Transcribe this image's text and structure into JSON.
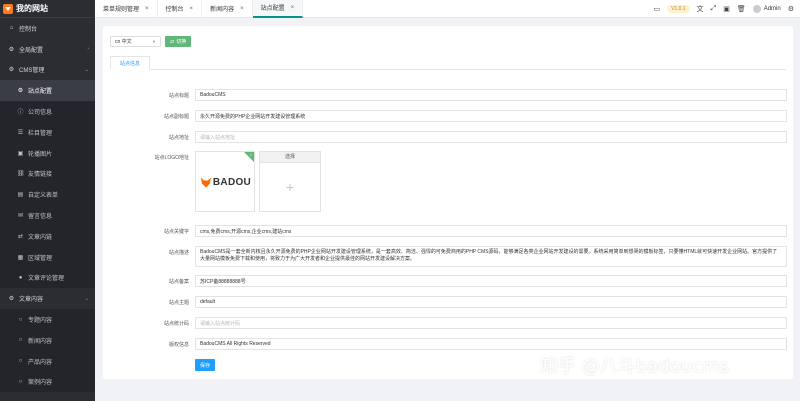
{
  "app": {
    "title": "我的网站"
  },
  "sidebar": {
    "items": [
      {
        "label": "控制台",
        "icon": "dashboard-icon",
        "kind": "top"
      },
      {
        "label": "全局配置",
        "icon": "gear-icon",
        "kind": "top",
        "arrow": "›"
      },
      {
        "label": "CMS管理",
        "icon": "gear-icon",
        "kind": "top",
        "arrow": "⌄"
      },
      {
        "label": "站点配置",
        "icon": "gear-icon",
        "kind": "sub",
        "active": true
      },
      {
        "label": "公司信息",
        "icon": "info-icon",
        "kind": "sub"
      },
      {
        "label": "栏目管理",
        "icon": "list-icon",
        "kind": "sub"
      },
      {
        "label": "轮播图片",
        "icon": "image-icon",
        "kind": "sub"
      },
      {
        "label": "友情链接",
        "icon": "link-icon",
        "kind": "sub"
      },
      {
        "label": "自定义表单",
        "icon": "form-icon",
        "kind": "sub"
      },
      {
        "label": "留言信息",
        "icon": "message-icon",
        "kind": "sub"
      },
      {
        "label": "文章内链",
        "icon": "shuffle-icon",
        "kind": "sub"
      },
      {
        "label": "区域管理",
        "icon": "region-icon",
        "kind": "sub"
      },
      {
        "label": "文章评论管理",
        "icon": "comment-icon",
        "kind": "sub"
      },
      {
        "label": "文章内容",
        "icon": "gear-icon",
        "kind": "top",
        "arrow": "⌄"
      },
      {
        "label": "专题内容",
        "icon": "circle-icon",
        "kind": "sub"
      },
      {
        "label": "新闻内容",
        "icon": "circle-icon",
        "kind": "sub"
      },
      {
        "label": "产品内容",
        "icon": "circle-icon",
        "kind": "sub"
      },
      {
        "label": "案例内容",
        "icon": "circle-icon",
        "kind": "sub"
      }
    ]
  },
  "topbar": {
    "tabs": [
      {
        "label": "菜单规则管理",
        "active": false
      },
      {
        "label": "控制台",
        "active": false
      },
      {
        "label": "新闻内容",
        "active": false
      },
      {
        "label": "站点配置",
        "active": true
      }
    ],
    "close": "×",
    "version": "V1.0.1",
    "user": "Admin"
  },
  "main": {
    "lang_select": "cn 中文",
    "switch_button": "切换",
    "subtab": "站点信息",
    "fields": [
      {
        "label": "站点标题",
        "value": "BadouCMS",
        "placeholder": false
      },
      {
        "label": "站点副标题",
        "value": "永久开源免费的PHP企业网站开发建设管理系统",
        "placeholder": false
      },
      {
        "label": "站点地址",
        "value": "请输入站点地址",
        "placeholder": true
      },
      {
        "label": "站点关键字",
        "value": "cms,免费cms,开源cms,企业cms,建站cms",
        "placeholder": false
      },
      {
        "label": "站点描述",
        "value": "BadouCMS是一套全新内核且永久开源免费的PHP企业网站开发建设管理系统，是一套高效、简洁、强悍的可免费商用的PHP CMS源码，能够满足各类企业网站开发建设的需要。系统采用简单到想哭的模板标签，只要懂HTML就可快速开发企业网站。官方提供了大量网站模板免费下载和使用，将致力于为广大开发者和企业提供最佳的网站开发建设解决方案。",
        "placeholder": false,
        "tall": true
      },
      {
        "label": "站点备案",
        "value": "苏ICP备88888888号",
        "placeholder": false
      },
      {
        "label": "站点主题",
        "value": "default",
        "placeholder": false
      },
      {
        "label": "站点统计码",
        "value": "请输入站点统计码",
        "placeholder": true
      },
      {
        "label": "版权信息",
        "value": "BadouCMS All Rights Reserved",
        "placeholder": false
      }
    ],
    "logo_label": "站点LOGO地址",
    "logo_text": "BADOU",
    "pick_title": "选择",
    "pick_plus": "+",
    "save_button": "保存"
  },
  "watermark": "知乎 @八斗badoucms",
  "colors": {
    "sidebar": "#2b2d33",
    "accent_green": "#5fb878",
    "accent_blue": "#1e9fff"
  }
}
